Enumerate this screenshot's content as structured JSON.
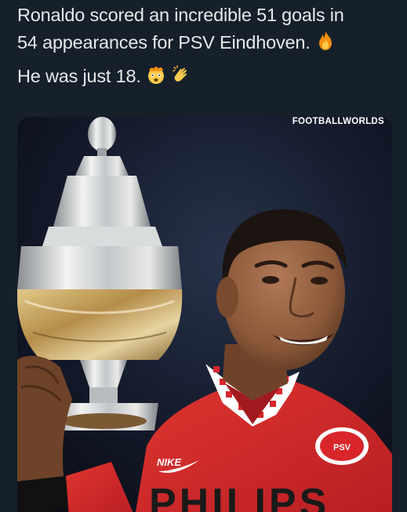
{
  "tweet": {
    "line1": "Ronaldo scored an incredible 51 goals in",
    "line2": "54 appearances for PSV Eindhoven.",
    "line3": "He was just 18.",
    "emojis": [
      "fire-emoji",
      "exploding-head-emoji",
      "clapping-hands-emoji"
    ]
  },
  "media": {
    "watermark": "FOOTBALLWORLDS",
    "jersey_sponsor": "PHILIPS",
    "badge_text": "PSV",
    "kit_logo": "NIKE"
  },
  "colors": {
    "background": "#15202b",
    "text": "#e7e9ea",
    "jersey_red": "#d8262b",
    "trophy_silver": "#cfd3d6"
  }
}
